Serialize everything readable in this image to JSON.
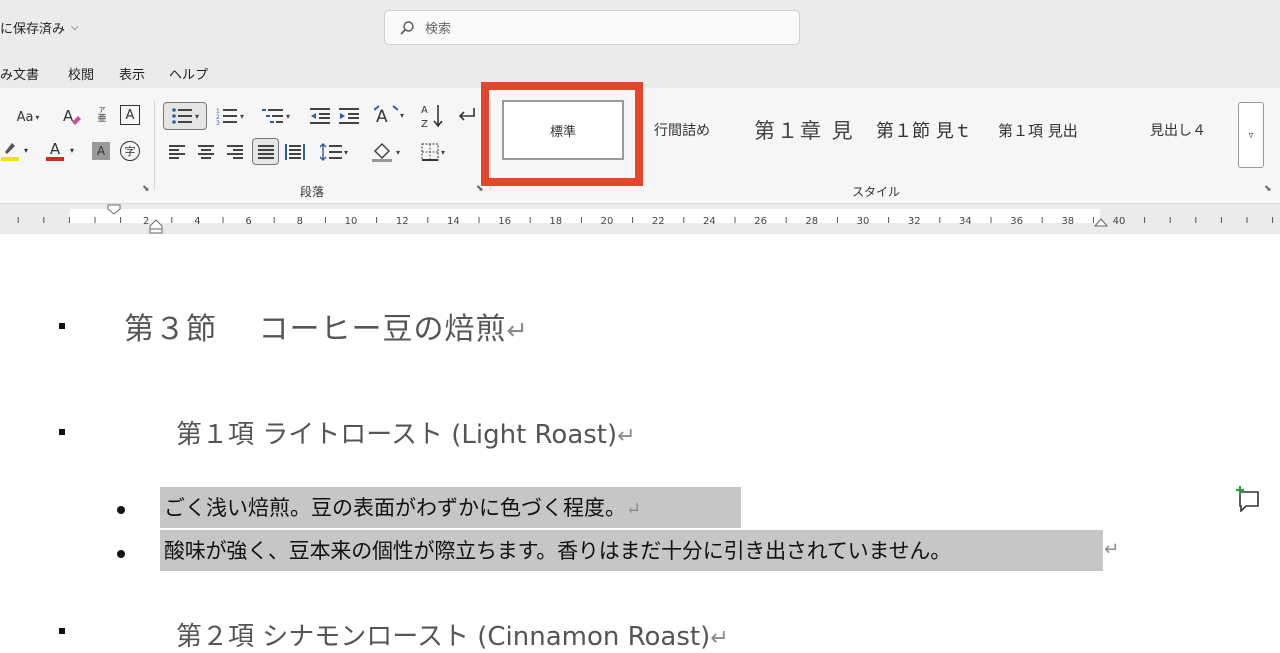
{
  "titlebar": {
    "doc_status": "に保存済み",
    "search_placeholder": "検索"
  },
  "tabs": [
    "み文書",
    "校閲",
    "表示",
    "ヘルプ"
  ],
  "ribbon": {
    "font": {
      "case_label": "Aa",
      "ruby_label": "亜",
      "box_char_label": "A",
      "shade_char_label": "A",
      "enclose_char_label": "字",
      "font_color_letter": "A",
      "highlight_color": "#f2e600",
      "font_color": "#d12b1e"
    },
    "paragraph_label": "段落",
    "styles_label": "スタイル",
    "styles": [
      {
        "name": "標準",
        "selected": true
      },
      {
        "name": "行間詰め"
      },
      {
        "name": "第１章 見"
      },
      {
        "name": "第１節 見ｔ"
      },
      {
        "name": "第１項 見出"
      },
      {
        "name": "見出し４"
      }
    ]
  },
  "ruler": {
    "labels": [
      "2",
      "4",
      "6",
      "8",
      "10",
      "12",
      "14",
      "16",
      "18",
      "20",
      "22",
      "24",
      "26",
      "28",
      "30",
      "32",
      "34",
      "36",
      "38",
      "40"
    ]
  },
  "document": {
    "section_heading": "第３節　 コーヒー豆の焙煎",
    "item1_heading": "第１項 ライトロースト (Light Roast)",
    "item1_bullets": [
      "ごく浅い焙煎。豆の表面がわずかに色づく程度。",
      "酸味が強く、豆本来の個性が際立ちます。香りはまだ十分に引き出されていません。"
    ],
    "item2_heading": "第２項 シナモンロースト (Cinnamon Roast)",
    "paragraph_mark": "↵"
  },
  "colors": {
    "highlight_outline": "#e3462b",
    "selection_bg": "#c6c6c6",
    "comment_plus": "#2e9e3e"
  }
}
